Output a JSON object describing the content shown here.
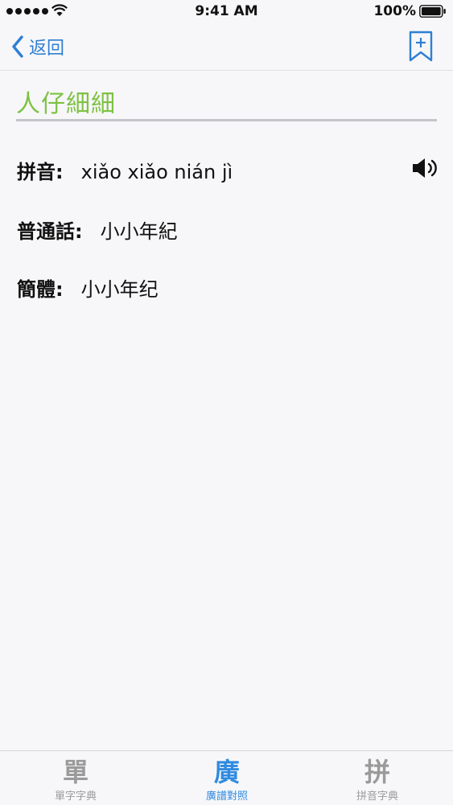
{
  "status_bar": {
    "time": "9:41 AM",
    "battery_percent": "100%"
  },
  "nav": {
    "back_label": "返回"
  },
  "entry": {
    "headword": "人仔細細",
    "pinyin_label": "拼音:",
    "pinyin_value": "xiǎo xiǎo nián jì",
    "mandarin_label": "普通話:",
    "mandarin_value": "小小年紀",
    "simplified_label": "簡體:",
    "simplified_value": "小小年纪"
  },
  "tabs": [
    {
      "icon": "單",
      "label": "單字字典",
      "active": false
    },
    {
      "icon": "廣",
      "label": "廣譜對照",
      "active": true
    },
    {
      "icon": "拼",
      "label": "拼音字典",
      "active": false
    }
  ],
  "colors": {
    "accent": "#2f7fd3",
    "headword": "#7ec242",
    "inactive": "#9a9a9a"
  }
}
